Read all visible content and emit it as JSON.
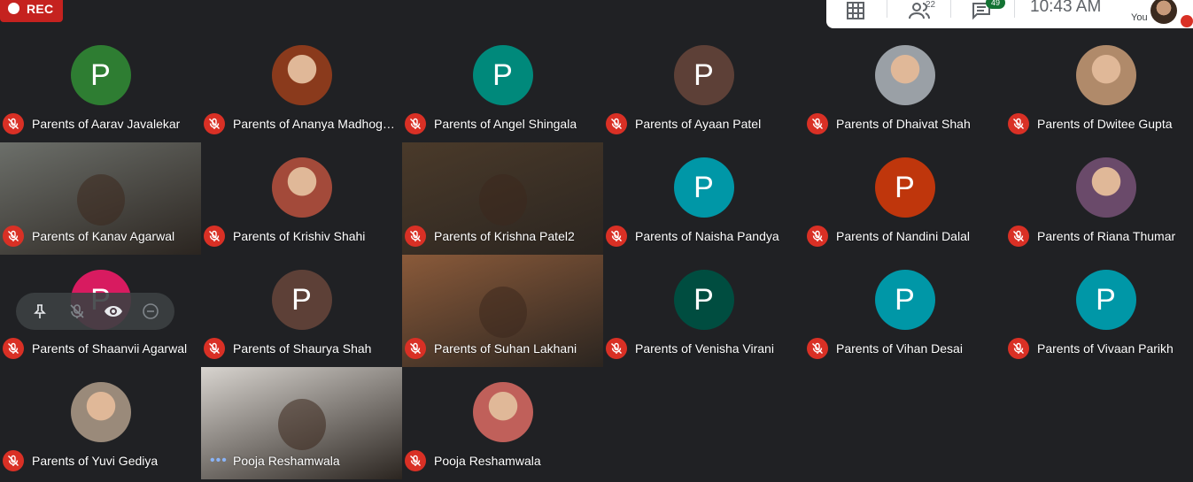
{
  "recording": {
    "label": "REC"
  },
  "topbar": {
    "participants_count": "22",
    "chat_count": "49",
    "time": "10:43  AM",
    "you_label": "You"
  },
  "tiles": [
    {
      "name": "Parents of Aarav Javalekar",
      "initial": "P",
      "color": "#2e7d32",
      "type": "initial"
    },
    {
      "name": "Parents of Ananya Madhog…",
      "initial": "",
      "color": "#8a3a1c",
      "type": "photo"
    },
    {
      "name": "Parents of Angel Shingala",
      "initial": "P",
      "color": "#00897b",
      "type": "initial"
    },
    {
      "name": "Parents of Ayaan Patel",
      "initial": "P",
      "color": "#5d4037",
      "type": "initial"
    },
    {
      "name": "Parents of Dhaivat Shah",
      "initial": "",
      "color": "#9aa0a6",
      "type": "photo"
    },
    {
      "name": "Parents of Dwitee Gupta",
      "initial": "",
      "color": "#b08a6a",
      "type": "photo"
    },
    {
      "name": "Parents of Kanav Agarwal",
      "initial": "",
      "color": "#6c6f6a",
      "type": "video"
    },
    {
      "name": "Parents of Krishiv Shahi",
      "initial": "",
      "color": "#a34a3a",
      "type": "photo"
    },
    {
      "name": "Parents of Krishna Patel2",
      "initial": "",
      "color": "#4a3a2a",
      "type": "video"
    },
    {
      "name": "Parents of Naisha Pandya",
      "initial": "P",
      "color": "#0097a7",
      "type": "initial"
    },
    {
      "name": "Parents of Nandini Dalal",
      "initial": "P",
      "color": "#bf360c",
      "type": "initial"
    },
    {
      "name": "Parents of Riana Thumar",
      "initial": "",
      "color": "#6a4a6a",
      "type": "photo"
    },
    {
      "name": "Parents of Shaanvii Agarwal",
      "initial": "P",
      "color": "#d81b60",
      "type": "initial"
    },
    {
      "name": "Parents of Shaurya Shah",
      "initial": "P",
      "color": "#5d4037",
      "type": "initial"
    },
    {
      "name": "Parents of Suhan Lakhani",
      "initial": "",
      "color": "#8a5a3a",
      "type": "video"
    },
    {
      "name": "Parents of Venisha Virani",
      "initial": "P",
      "color": "#004d40",
      "type": "initial"
    },
    {
      "name": "Parents of Vihan Desai",
      "initial": "P",
      "color": "#0097a7",
      "type": "initial"
    },
    {
      "name": "Parents of Vivaan Parikh",
      "initial": "P",
      "color": "#0097a7",
      "type": "initial"
    },
    {
      "name": "Parents of Yuvi Gediya",
      "initial": "",
      "color": "#9a8a7a",
      "type": "photo"
    },
    {
      "name": "Pooja Reshamwala",
      "initial": "",
      "color": "#d8d4cf",
      "type": "video"
    },
    {
      "name": "Pooja Reshamwala",
      "initial": "",
      "color": "#c0605a",
      "type": "photo"
    }
  ]
}
